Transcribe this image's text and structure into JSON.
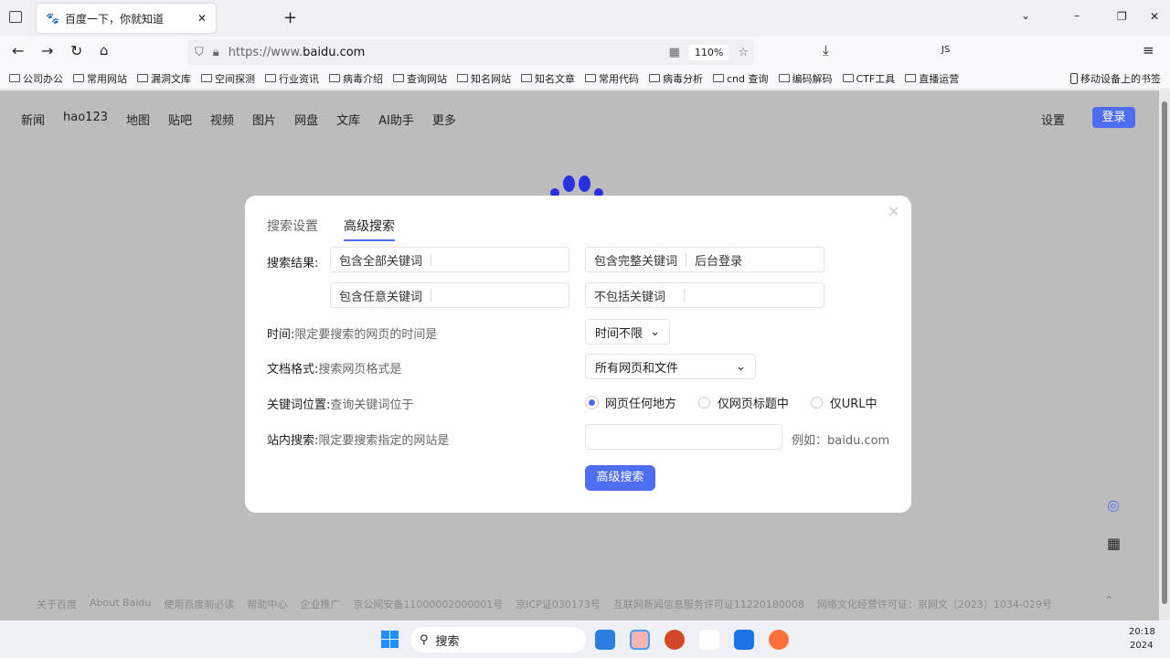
{
  "browser": {
    "tab_title": "百度一下，你就知道",
    "url_prefix": "https://www.",
    "url_domain": "baidu.com",
    "zoom": "110%",
    "bookmarks": [
      "公司办公",
      "常用网站",
      "漏洞文库",
      "空间探测",
      "行业资讯",
      "病毒介绍",
      "查询网站",
      "知名网站",
      "知名文章",
      "常用代码",
      "病毒分析",
      "cnd 查询",
      "编码解码",
      "CTF工具",
      "直播运营"
    ],
    "mobile_bookmarks": "移动设备上的书签",
    "ext_js": "JS"
  },
  "nav": {
    "links": [
      "新闻",
      "hao123",
      "地图",
      "贴吧",
      "视频",
      "图片",
      "网盘",
      "文库",
      "AI助手",
      "更多"
    ],
    "settings": "设置",
    "login": "登录"
  },
  "dialog": {
    "tabs": [
      "搜索设置",
      "高级搜索"
    ],
    "results_label": "搜索结果:",
    "all_keywords": "包含全部关键词",
    "exact_phrase": "包含完整关键词",
    "exact_phrase_value": "后台登录",
    "any_keywords": "包含任意关键词",
    "exclude_keywords": "不包括关键词",
    "time_label": "时间:",
    "time_desc": "限定要搜索的网页的时间是",
    "time_value": "时间不限",
    "format_label": "文档格式:",
    "format_desc": "搜索网页格式是",
    "format_value": "所有网页和文件",
    "position_label": "关键词位置:",
    "position_desc": "查询关键词位于",
    "positions": [
      "网页任何地方",
      "仅网页标题中",
      "仅URL中"
    ],
    "site_label": "站内搜索:",
    "site_desc": "限定要搜索指定的网站是",
    "site_example": "例如：baidu.com",
    "submit": "高级搜索"
  },
  "footer": [
    "关于百度",
    "About Baidu",
    "使用百度前必读",
    "帮助中心",
    "企业推广",
    "京公网安备11000002000001号",
    "京ICP证030173号",
    "互联网新闻信息服务许可证11220180008",
    "网络文化经营许可证：京网文〔2023〕1034-029号"
  ],
  "taskbar": {
    "search": "搜索",
    "time": "20:18",
    "year": "2024"
  }
}
